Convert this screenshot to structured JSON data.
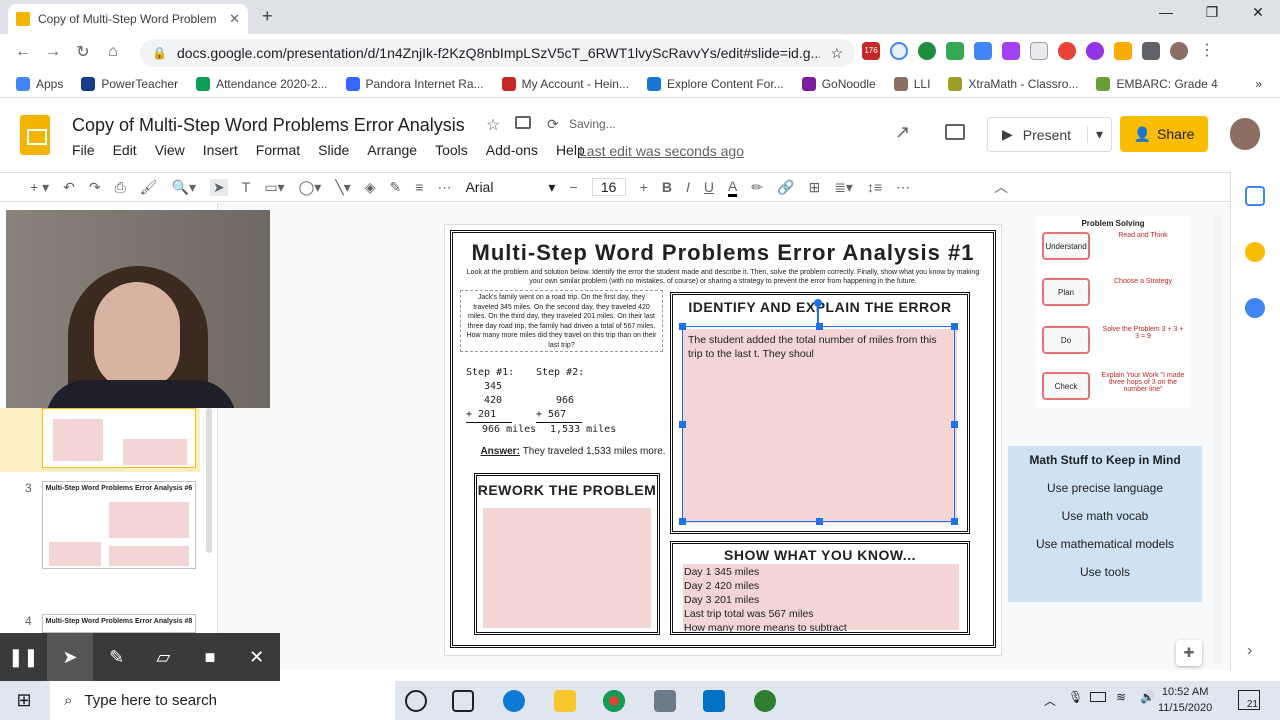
{
  "browser": {
    "tab_title": "Copy of Multi-Step Word Problem",
    "new_tab": "+",
    "url": "docs.google.com/presentation/d/1n4ZnjIk-f2KzQ8nbImpLSzV5cT_6RWT1lvyScRavvYs/edit#slide=id.g...",
    "ext_badge": "176",
    "bookmarks": [
      "Apps",
      "PowerTeacher",
      "Attendance 2020-2...",
      "Pandora Internet Ra...",
      "My Account - Hein...",
      "Explore Content For...",
      "GoNoodle",
      "LLI",
      "XtraMath - Classro...",
      "EMBARC: Grade 4"
    ]
  },
  "docs": {
    "title": "Copy of Multi-Step Word Problems Error Analysis",
    "status": "Saving...",
    "menus": [
      "File",
      "Edit",
      "View",
      "Insert",
      "Format",
      "Slide",
      "Arrange",
      "Tools",
      "Add-ons",
      "Help"
    ],
    "last_edit": "Last edit was seconds ago",
    "present_label": "Present",
    "share_label": "Share",
    "font_name": "Arial",
    "font_size": "16"
  },
  "sidebar": {
    "slide_numbers": [
      "3",
      "4"
    ],
    "thumb_titles": [
      "Multi-Step Word Problems Error Analysis #6",
      "Multi-Step Word Problems Error Analysis #8"
    ]
  },
  "slide": {
    "title": "Multi-Step Word Problems Error Analysis #1",
    "instructions": "Look at the problem and solution below. Identify the error the student made and describe it. Then, solve the problem correctly. Finally, show what you know by making your own similar problem (with no mistakes, of course) or sharing a strategy to prevent the error from happening in the future.",
    "problem": "Jack's family went on a road trip. On the first day, they traveled 345 miles. On the second day, they traveled 420 miles. On the third day, they traveled 201 miles. On their last three day road trip, the family had driven a total of 567 miles. How many more miles did they travel on this trip than on their last trip?",
    "step1_label": "Step #1:",
    "step1_lines": [
      "345",
      "420",
      "+ 201",
      "966 miles"
    ],
    "step2_label": "Step #2:",
    "step2_lines": [
      "966",
      "+ 567",
      "1,533 miles"
    ],
    "answer_label": "Answer:",
    "answer_text": "They traveled 1,533 miles more.",
    "identify_heading": "IDENTIFY AND EXPLAIN THE ERROR",
    "identify_text": "The student added the total number of miles from this trip to the last t.   They shoul",
    "rework_heading": "REWORK THE PROBLEM",
    "show_heading": "SHOW WHAT YOU KNOW...",
    "show_items": [
      "Day 1 345 miles",
      "Day 2 420 miles",
      "Day 3 201 miles",
      "Last trip total was 567 miles",
      "How many more means to subtract"
    ]
  },
  "problem_solving": {
    "title": "Problem Solving",
    "steps": [
      {
        "label": "Understand",
        "desc": "Read and Think"
      },
      {
        "label": "Plan",
        "desc": "Choose a Strategy"
      },
      {
        "label": "Do",
        "desc": "Solve the Problem 3 + 3 + 3 = 9"
      },
      {
        "label": "Check",
        "desc": "Explain Your Work \"I made three hops of 3 on the number line\""
      }
    ]
  },
  "math_stuff": {
    "heading": "Math Stuff to Keep in Mind",
    "items": [
      "Use precise language",
      "Use math vocab",
      "Use mathematical models",
      "Use tools"
    ]
  },
  "taskbar": {
    "search_placeholder": "Type here to search",
    "time": "10:52 AM",
    "date": "11/15/2020",
    "notif_count": "21"
  },
  "colors": {
    "accent_share": "#fbbc04",
    "docs_logo": "#f4b400",
    "selection": "#1a73e8",
    "pink_fill": "#f3d5d5",
    "math_panel": "#cfe2f3"
  }
}
